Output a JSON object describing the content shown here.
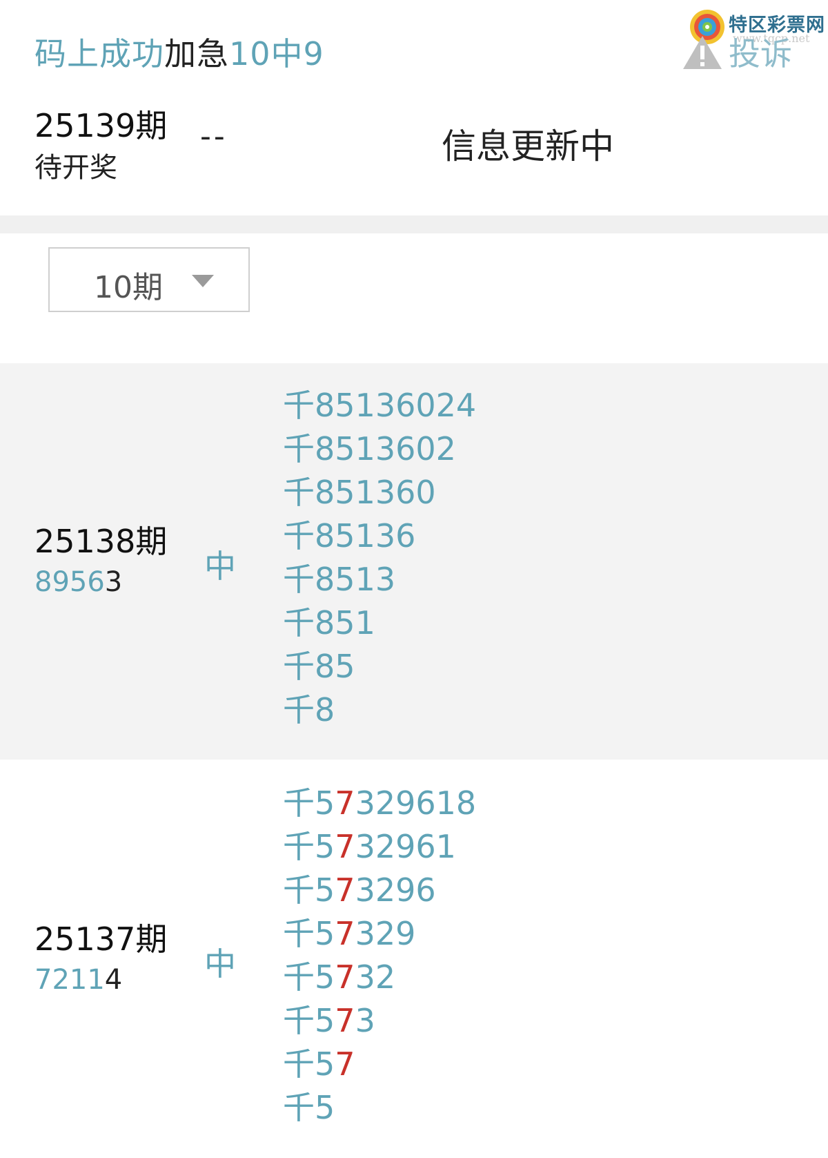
{
  "header": {
    "title_parts": [
      {
        "text": "码上成功",
        "tone": "blue"
      },
      {
        "text": "加急",
        "tone": "dark"
      },
      {
        "text": "10中9",
        "tone": "blue"
      }
    ],
    "complain_label": "投诉",
    "logo": {
      "brand": "特区彩票网",
      "url": "www.tqcp.net"
    }
  },
  "current": {
    "issue": "25139期",
    "status": "待开奖",
    "dash": "--",
    "info": "信息更新中"
  },
  "filter": {
    "selected": "10期"
  },
  "records": [
    {
      "issue": "25138期",
      "draw_prefix": "8956",
      "draw_last": "3",
      "result": "中",
      "hit_digit": "8",
      "picks": [
        "千85136024",
        "千8513602",
        "千851360",
        "千85136",
        "千8513",
        "千851",
        "千85",
        "千8"
      ]
    },
    {
      "issue": "25137期",
      "draw_prefix": "7211",
      "draw_last": "4",
      "result": "中",
      "hit_digit": "7",
      "picks": [
        "千57329618",
        "千5732961",
        "千573296",
        "千57329",
        "千5732",
        "千573",
        "千57",
        "千5"
      ]
    }
  ],
  "colors": {
    "accent_blue": "#5fa3b6",
    "hit_red": "#c8312a",
    "row_gray": "#f3f3f3"
  }
}
